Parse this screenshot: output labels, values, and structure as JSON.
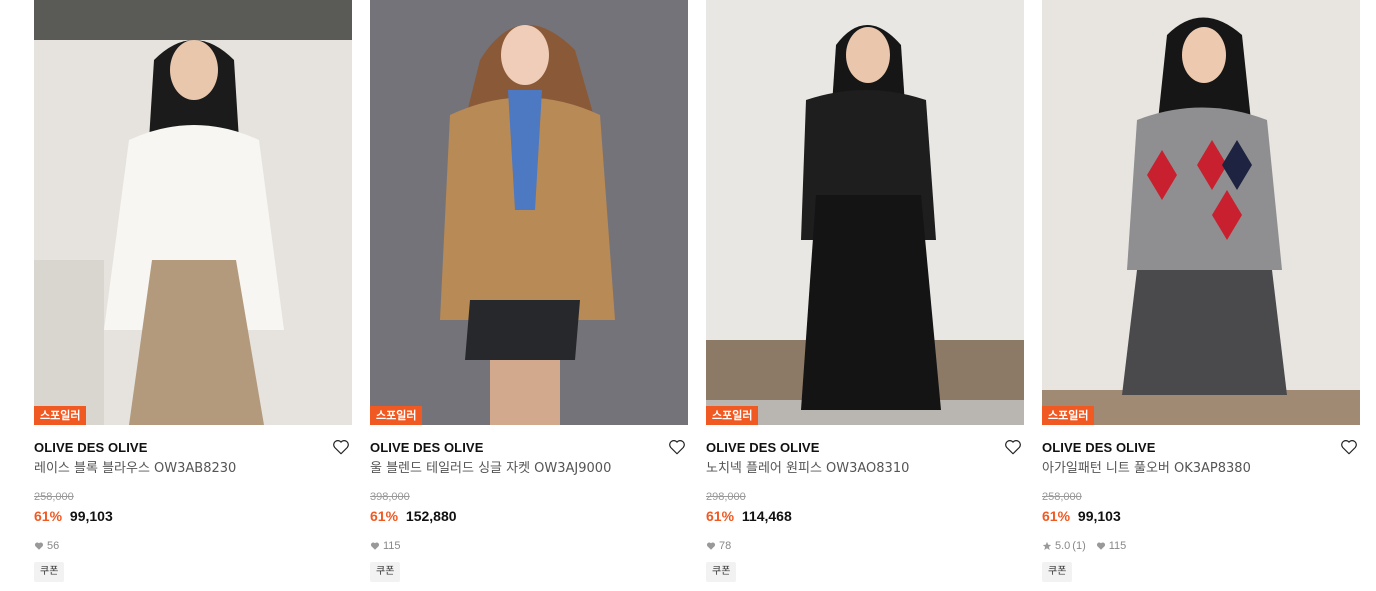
{
  "products": [
    {
      "badge": "스포일러",
      "brand": "OLIVE DES OLIVE",
      "name": "레이스 블록 블라우스 OW3AB8230",
      "original_price": "258,000",
      "discount": "61%",
      "price": "99,103",
      "likes": "56",
      "coupon": "쿠폰"
    },
    {
      "badge": "스포일러",
      "brand": "OLIVE DES OLIVE",
      "name": "울 블렌드 테일러드 싱글 자켓 OW3AJ9000",
      "original_price": "398,000",
      "discount": "61%",
      "price": "152,880",
      "likes": "115",
      "coupon": "쿠폰"
    },
    {
      "badge": "스포일러",
      "brand": "OLIVE DES OLIVE",
      "name": "노치넥 플레어 원피스 OW3AO8310",
      "original_price": "298,000",
      "discount": "61%",
      "price": "114,468",
      "likes": "78",
      "coupon": "쿠폰"
    },
    {
      "badge": "스포일러",
      "brand": "OLIVE DES OLIVE",
      "name": "아가일패턴 니트 풀오버 OK3AP8380",
      "original_price": "258,000",
      "discount": "61%",
      "price": "99,103",
      "rating": "5.0",
      "review_count": "(1)",
      "likes": "115",
      "coupon": "쿠폰"
    }
  ],
  "colors": {
    "accent": "#f05a22",
    "strike": "#999999",
    "name": "#555555"
  },
  "icons": {
    "wish": "heart-outline-icon",
    "likes": "heart-filled-icon",
    "rating": "star-icon"
  }
}
